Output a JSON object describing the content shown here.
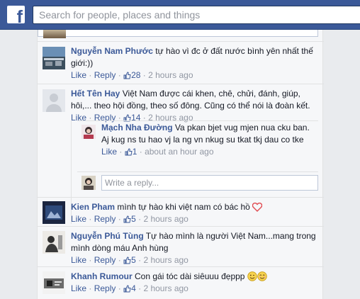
{
  "topbar": {
    "logo": "f",
    "search_placeholder": "Search for people, places and things"
  },
  "actions": {
    "like": "Like",
    "reply": "Reply",
    "sep": "·"
  },
  "comments": [
    {
      "name": "Nguyễn Nam Phước",
      "text": "tự hào vì đc ở đất nước bình yên nhất thế giới:))",
      "likes": "28",
      "time": "2 hours ago"
    },
    {
      "name": "Hết Tên Hay",
      "text": "Việt Nam được cái khen, chê, chửi, đánh, giúp, hôi,... theo hội đồng, theo số đông. Cũng có thể nói là đoàn kết.",
      "likes": "14",
      "time": "2 hours ago",
      "replies": [
        {
          "name": "Mạch Nha Đường",
          "text": "Va pkan bjet vug mjen nua cku ban. Aj kug ns tu hao vj la ng vn nkug su tkat tkj dau co tke",
          "likes": "1",
          "time": "about an hour ago"
        }
      ],
      "write_reply_placeholder": "Write a reply..."
    },
    {
      "name": "Kien Pham",
      "text": "mình tự hào khi việt nam có bác hồ",
      "emoji": "heart-icon",
      "likes": "5",
      "time": "2 hours ago"
    },
    {
      "name": "Nguyễn Phú Tùng",
      "text": "Tự hào mình là người Việt Nam...mang trong mình dòng máu Anh hùng",
      "likes": "5",
      "time": "2 hours ago"
    },
    {
      "name": "Khanh Rumour",
      "text": "Con gái tóc dài siêuuu đẹppp",
      "emoji": "wink-smile-icon",
      "likes": "4",
      "time": "2 hours ago"
    }
  ],
  "colors": {
    "topbar": "#3b5998",
    "link": "#3b5998",
    "meta": "#9197a3",
    "panel_bg": "#f6f7f9",
    "heart": "#e0484e"
  }
}
